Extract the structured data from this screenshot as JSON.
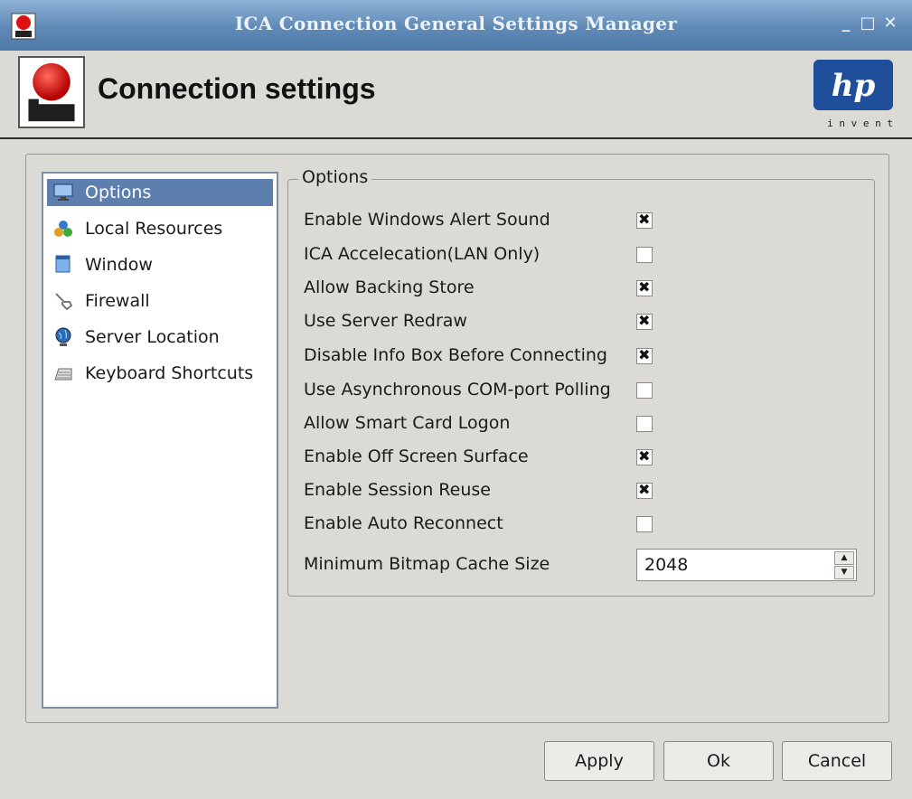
{
  "window": {
    "title": "ICA Connection General Settings Manager",
    "controls": [
      "_",
      "□",
      "✕"
    ]
  },
  "header": {
    "title": "Connection settings",
    "logo_text": "hp",
    "logo_tagline": "i n v e n t"
  },
  "sidebar": {
    "items": [
      {
        "label": "Options",
        "icon": "monitor-icon",
        "selected": true
      },
      {
        "label": "Local Resources",
        "icon": "resources-icon",
        "selected": false
      },
      {
        "label": "Window",
        "icon": "window-icon",
        "selected": false
      },
      {
        "label": "Firewall",
        "icon": "firewall-icon",
        "selected": false
      },
      {
        "label": "Server Location",
        "icon": "globe-icon",
        "selected": false
      },
      {
        "label": "Keyboard Shortcuts",
        "icon": "keyboard-icon",
        "selected": false
      }
    ]
  },
  "options": {
    "legend": "Options",
    "items": [
      {
        "label": "Enable Windows Alert Sound",
        "checked": true
      },
      {
        "label": "ICA Accelecation(LAN Only)",
        "checked": false
      },
      {
        "label": "Allow Backing Store",
        "checked": true
      },
      {
        "label": "Use Server Redraw",
        "checked": true
      },
      {
        "label": "Disable Info Box Before Connecting",
        "checked": true
      },
      {
        "label": "Use Asynchronous COM-port Polling",
        "checked": false
      },
      {
        "label": "Allow Smart Card Logon",
        "checked": false
      },
      {
        "label": "Enable Off Screen Surface",
        "checked": true
      },
      {
        "label": "Enable Session Reuse",
        "checked": true
      },
      {
        "label": "Enable Auto Reconnect",
        "checked": false
      }
    ],
    "bitmap_cache": {
      "label": "Minimum Bitmap Cache Size",
      "value": "2048"
    }
  },
  "buttons": {
    "apply": "Apply",
    "ok": "Ok",
    "cancel": "Cancel"
  },
  "colors": {
    "titlebar": "#5f89b6",
    "selection": "#5c7fad",
    "background": "#dcdad5"
  }
}
